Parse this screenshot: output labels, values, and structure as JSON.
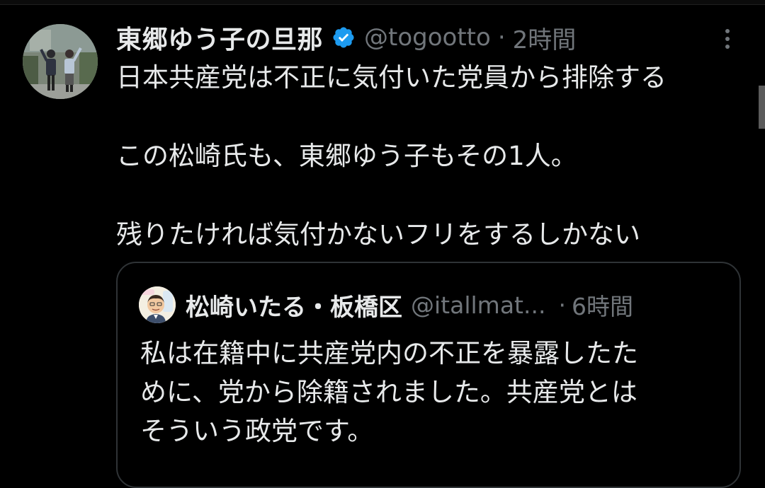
{
  "tweet": {
    "display_name": "東郷ゆう子の旦那",
    "handle": "@togootto",
    "separator": "·",
    "time": "2時間",
    "lines": [
      "日本共産党は不正に気付いた党員から排除する",
      "この松崎氏も、東郷ゆう子もその1人。",
      "残りたければ気付かないフリをするしかない"
    ]
  },
  "quoted_tweet": {
    "display_name": "松崎いたる・板橋区",
    "handle": "@itallmat...",
    "separator": "·",
    "time": "6時間",
    "lines": [
      "私は在籍中に共産党内の不正を暴露したた",
      "めに、党から除籍されました。共産党とは",
      "そういう政党です。"
    ]
  },
  "icons": {
    "verified": "verified-badge-icon",
    "more": "more-options-icon"
  },
  "colors": {
    "background": "#000000",
    "text_primary": "#e7e9ea",
    "text_secondary": "#71767b",
    "verified_blue": "#1d9bf0",
    "border": "#2f3336"
  }
}
